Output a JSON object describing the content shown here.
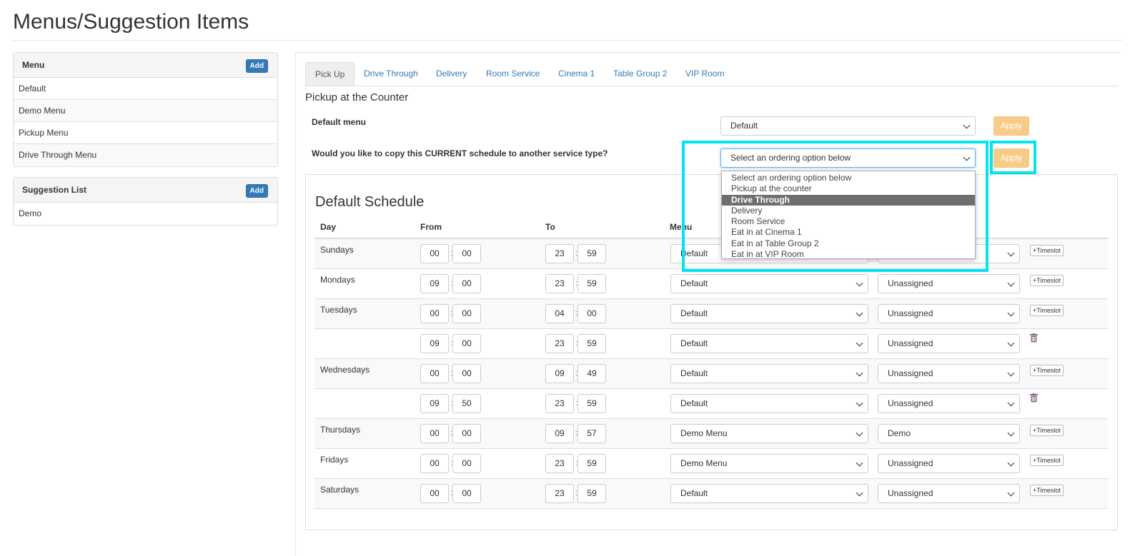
{
  "page": {
    "title": "Menus/Suggestion Items"
  },
  "menu_panel": {
    "title": "Menu",
    "add_label": "Add",
    "items": [
      "Default",
      "Demo Menu",
      "Pickup Menu",
      "Drive Through Menu"
    ]
  },
  "suggestion_panel": {
    "title": "Suggestion List",
    "add_label": "Add",
    "items": [
      "Demo"
    ]
  },
  "tabs": [
    "Pick Up",
    "Drive Through",
    "Delivery",
    "Room Service",
    "Cinema 1",
    "Table Group 2",
    "VIP Room"
  ],
  "active_tab": "Pick Up",
  "section_title": "Pickup at the Counter",
  "default_menu": {
    "label": "Default menu",
    "value": "Default",
    "apply_label": "Apply"
  },
  "copy_schedule": {
    "label": "Would you like to copy this CURRENT schedule to another service type?",
    "value": "Select an ordering option below",
    "apply_label": "Apply",
    "options": [
      "Select an ordering option below",
      "Pickup at the counter",
      "Drive Through",
      "Delivery",
      "Room Service",
      "Eat in at Cinema 1",
      "Eat in at Table Group 2",
      "Eat in at VIP Room"
    ],
    "highlighted_option": "Drive Through"
  },
  "schedule": {
    "title": "Default Schedule",
    "headers": {
      "day": "Day",
      "from": "From",
      "to": "To",
      "menu": "Menu"
    },
    "timeslot_label": "+Timeslot",
    "rows": [
      {
        "day": "Sundays",
        "from_h": "00",
        "from_m": "00",
        "to_h": "23",
        "to_m": "59",
        "menu": "Default",
        "suggestion": "",
        "action": "timeslot"
      },
      {
        "day": "Mondays",
        "from_h": "09",
        "from_m": "00",
        "to_h": "23",
        "to_m": "59",
        "menu": "Default",
        "suggestion": "Unassigned",
        "action": "timeslot"
      },
      {
        "day": "Tuesdays",
        "from_h": "00",
        "from_m": "00",
        "to_h": "04",
        "to_m": "00",
        "menu": "Default",
        "suggestion": "Unassigned",
        "action": "timeslot"
      },
      {
        "day": "",
        "from_h": "09",
        "from_m": "00",
        "to_h": "23",
        "to_m": "59",
        "menu": "Default",
        "suggestion": "Unassigned",
        "action": "delete"
      },
      {
        "day": "Wednesdays",
        "from_h": "00",
        "from_m": "00",
        "to_h": "09",
        "to_m": "49",
        "menu": "Default",
        "suggestion": "Unassigned",
        "action": "timeslot"
      },
      {
        "day": "",
        "from_h": "09",
        "from_m": "50",
        "to_h": "23",
        "to_m": "59",
        "menu": "Default",
        "suggestion": "Unassigned",
        "action": "delete"
      },
      {
        "day": "Thursdays",
        "from_h": "00",
        "from_m": "00",
        "to_h": "09",
        "to_m": "57",
        "menu": "Demo Menu",
        "suggestion": "Demo",
        "action": "timeslot"
      },
      {
        "day": "Fridays",
        "from_h": "00",
        "from_m": "00",
        "to_h": "23",
        "to_m": "59",
        "menu": "Demo Menu",
        "suggestion": "Unassigned",
        "action": "timeslot"
      },
      {
        "day": "Saturdays",
        "from_h": "00",
        "from_m": "00",
        "to_h": "23",
        "to_m": "59",
        "menu": "Default",
        "suggestion": "Unassigned",
        "action": "timeslot"
      }
    ]
  },
  "colors": {
    "link": "#337ab7",
    "apply": "#f8cc88",
    "highlight": "#00e6f0",
    "add": "#337ab7"
  }
}
